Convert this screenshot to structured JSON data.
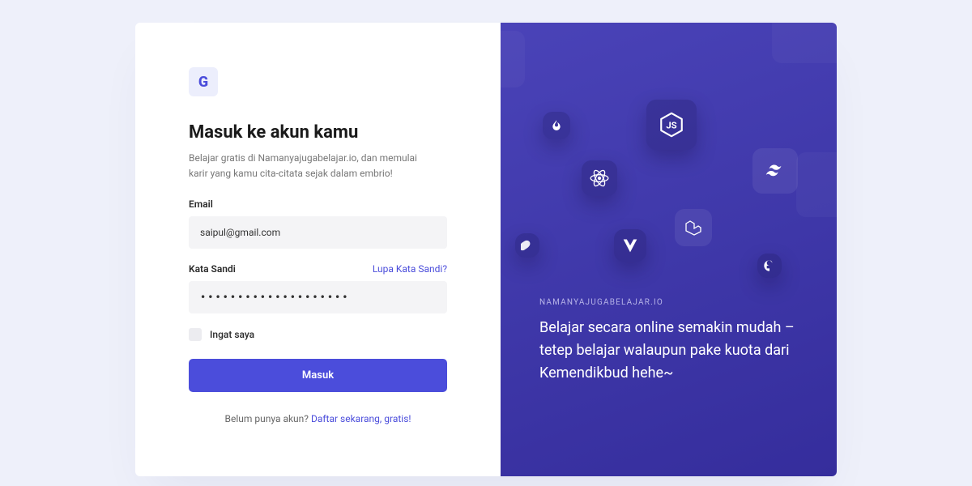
{
  "logo_letter": "G",
  "form": {
    "title": "Masuk ke akun kamu",
    "subtitle": "Belajar gratis di Namanyajugabelajar.io, dan memulai karir yang kamu cita-citata sejak dalam embrio!",
    "email_label": "Email",
    "email_value": "saipul@gmail.com",
    "password_label": "Kata Sandi",
    "forgot_label": "Lupa Kata Sandi?",
    "password_mask": "••••••••••••••••••••",
    "remember_label": "Ingat saya",
    "submit_label": "Masuk",
    "signup_prompt": "Belum punya akun? ",
    "signup_link": "Daftar sekarang, gratis!"
  },
  "promo": {
    "brand": "NAMANYAJUGABELAJAR.IO",
    "tagline": "Belajar secara online semakin mudah – tetep belajar walaupun pake kuota dari Kemendikbud hehe~"
  },
  "icons": [
    "flame",
    "nodejs",
    "react",
    "tailwind",
    "svelte",
    "vue",
    "laravel",
    "digitalocean"
  ]
}
